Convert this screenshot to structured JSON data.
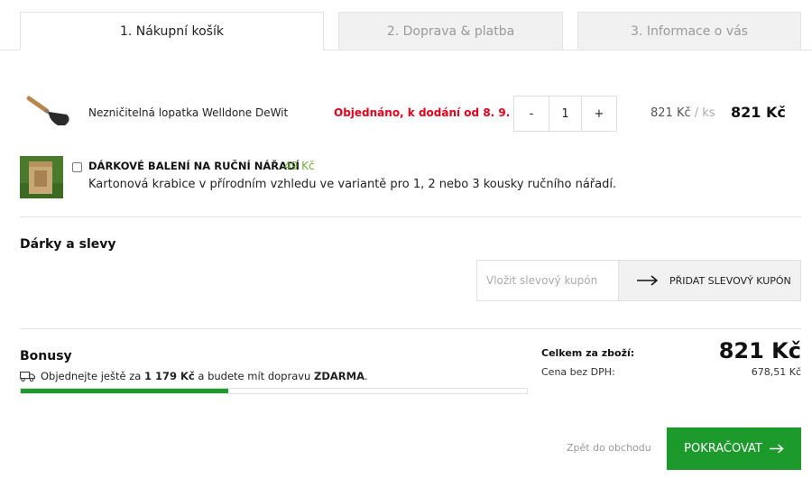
{
  "tabs": [
    {
      "label": "1. Nákupní košík"
    },
    {
      "label": "2. Doprava & platba"
    },
    {
      "label": "3. Informace o vás"
    }
  ],
  "product": {
    "name": "Nezničitelná lopatka Welldone DeWit",
    "status": "Objednáno, k dodání od 8. 9.",
    "quantity": "1",
    "minus": "-",
    "plus": "+",
    "unit_price": "821 Kč",
    "unit_sep": "/",
    "unit_label": "ks",
    "total": "821 Kč",
    "image": "trowel-image"
  },
  "gift": {
    "title": "DÁRKOVÉ BALENÍ NA RUČNÍ NÁŘADÍ",
    "price": "49 Kč",
    "description": "Kartonová krabice v přírodním vzhledu ve variantě pro 1, 2 nebo 3 kousky ručního nářadí.",
    "checked": false,
    "image": "gift-box-image"
  },
  "discounts": {
    "title": "Dárky a slevy",
    "placeholder": "Vložit slevový kupón",
    "button": "PŘIDAT SLEVOVÝ KUPÓN"
  },
  "bonus": {
    "title": "Bonusy",
    "text_prefix": "Objednejte ještě za",
    "amount": "1 179 Kč",
    "text_mid": "a budete mít dopravu",
    "free": "ZDARMA",
    "text_end": ".",
    "progress": 0.41,
    "icon": "truck-icon"
  },
  "summary": {
    "total_label": "Celkem za zboží:",
    "total_value": "821 Kč",
    "net_label": "Cena bez DPH:",
    "net_value": "678,51 Kč"
  },
  "actions": {
    "back": "Zpět do obchodu",
    "continue": "POKRAČOVAT"
  },
  "colors": {
    "accent": "#1d9a2c",
    "status": "#e3001b",
    "gift_price": "#6fae3b"
  }
}
